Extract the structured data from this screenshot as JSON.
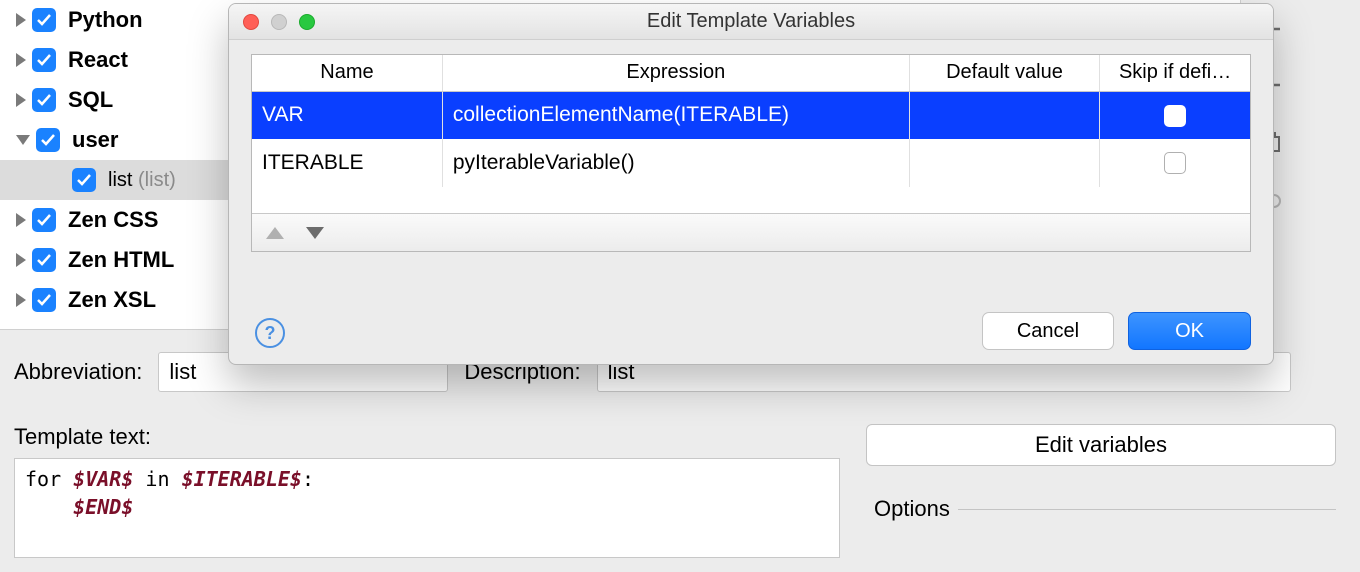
{
  "tree": {
    "items": [
      {
        "label": "Python",
        "expanded": false,
        "checked": true
      },
      {
        "label": "React",
        "expanded": false,
        "checked": true
      },
      {
        "label": "SQL",
        "expanded": false,
        "checked": true
      },
      {
        "label": "user",
        "expanded": true,
        "checked": true
      },
      {
        "label": "list",
        "suffix": "(list)",
        "checked": true,
        "child": true
      },
      {
        "label": "Zen CSS",
        "expanded": false,
        "checked": true
      },
      {
        "label": "Zen HTML",
        "expanded": false,
        "checked": true
      },
      {
        "label": "Zen XSL",
        "expanded": false,
        "checked": true
      }
    ]
  },
  "form": {
    "abbrev_label": "Abbreviation:",
    "abbrev_value": "list",
    "desc_label": "Description:",
    "desc_value": "list",
    "template_label": "Template text:",
    "template_kw1": "for ",
    "template_var1": "$VAR$",
    "template_kw2": " in ",
    "template_var2": "$ITERABLE$",
    "template_kw3": ":",
    "template_indent": "    ",
    "template_var3": "$END$",
    "edit_vars": "Edit variables",
    "options": "Options"
  },
  "dialog": {
    "title": "Edit Template Variables",
    "headers": {
      "name": "Name",
      "expr": "Expression",
      "def": "Default value",
      "skip": "Skip if defi…"
    },
    "rows": [
      {
        "name": "VAR",
        "expr": "collectionElementName(ITERABLE)",
        "def": "",
        "skip": false,
        "selected": true
      },
      {
        "name": "ITERABLE",
        "expr": "pyIterableVariable()",
        "def": "",
        "skip": false,
        "selected": false
      }
    ],
    "cancel": "Cancel",
    "ok": "OK",
    "help": "?"
  }
}
